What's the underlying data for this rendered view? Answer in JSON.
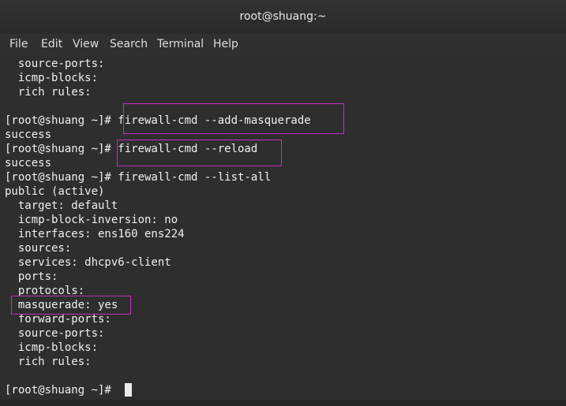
{
  "window": {
    "title": "root@shuang:~"
  },
  "menu": [
    "File",
    "Edit",
    "View",
    "Search",
    "Terminal",
    "Help"
  ],
  "terminal": {
    "lines": [
      "  source-ports:",
      "  icmp-blocks:",
      "  rich rules:",
      "",
      "[root@shuang ~]# firewall-cmd --add-masquerade",
      "success",
      "[root@shuang ~]# firewall-cmd --reload",
      "success",
      "[root@shuang ~]# firewall-cmd --list-all",
      "public (active)",
      "  target: default",
      "  icmp-block-inversion: no",
      "  interfaces: ens160 ens224",
      "  sources:",
      "  services: dhcpv6-client",
      "  ports:",
      "  protocols:",
      "  masquerade: yes",
      "  forward-ports:",
      "  source-ports:",
      "  icmp-blocks:",
      "  rich rules:",
      "",
      "[root@shuang ~]# "
    ]
  },
  "colors": {
    "highlight": "#c22fc2",
    "text": "#f0f0f0",
    "background": "#2e2e2e"
  }
}
